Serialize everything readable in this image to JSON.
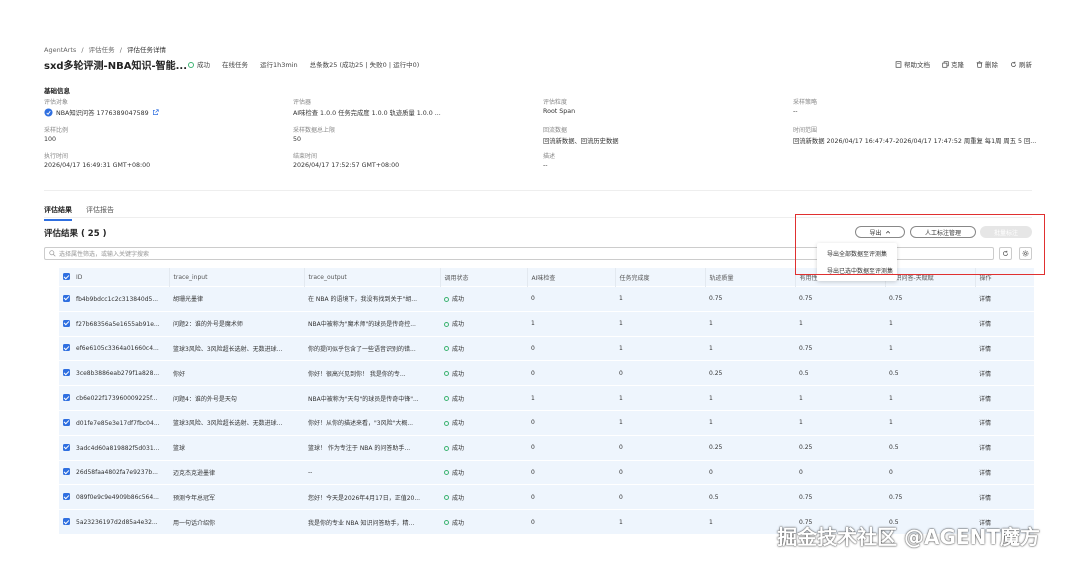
{
  "breadcrumb": [
    "AgentArts",
    "/",
    "评估任务",
    "/",
    "评估任务详情"
  ],
  "task": {
    "title": "sxd多轮评测-NBA知识-智能...",
    "status": "成功",
    "task_type": "在线任务",
    "run_time": "运行1h3min",
    "total": "总条数25 (成功25 | 失败0 | 运行中0)"
  },
  "toolbar": {
    "help": "帮助文档",
    "clone": "克隆",
    "delete": "删除",
    "refresh": "刷新"
  },
  "basic_info": {
    "section_title": "基础信息",
    "fields": [
      {
        "label": "评估对象",
        "value": "NBA知识问答  1776389047589"
      },
      {
        "label": "评估器",
        "value": "AI味检查  1.0.0  任务完成度  1.0.0  轨迹质量  1.0.0 ..."
      },
      {
        "label": "评估粒度",
        "value": "Root Span"
      },
      {
        "label": "采样策略",
        "value": "--"
      },
      {
        "label": "采样比例",
        "value": "100"
      },
      {
        "label": "采样数据总上限",
        "value": "50"
      },
      {
        "label": "回流数据",
        "value": "回流新数据、回流历史数据"
      },
      {
        "label": "时间范围",
        "value": "回流新数据 2026/04/17 16:47:47-2026/04/17 17:47:52 周重复 每1周 周五 5 回..."
      },
      {
        "label": "执行时间",
        "value": "2026/04/17 16:49:31 GMT+08:00"
      },
      {
        "label": "结束时间",
        "value": "2026/04/17 17:52:57 GMT+08:00"
      },
      {
        "label": "描述",
        "value": "--"
      }
    ]
  },
  "tabs": [
    "评估结果",
    "评估报告"
  ],
  "results": {
    "title": "评估结果 ( 25 )",
    "export_label": "导出",
    "annotate_label": "人工标注管理",
    "disabled_label": "批量标注",
    "export_menu": [
      "导出全部数据至评测集",
      "导出已选中数据至评测集"
    ],
    "search_placeholder": "选择属性筛选，或输入关键字搜索"
  },
  "table": {
    "headers": [
      "ID",
      "trace_input",
      "trace_output",
      "调用状态",
      "AI味检查",
      "任务完成度",
      "轨迹质量",
      "有用性",
      "知识问答-天赋赋",
      "操作"
    ],
    "rows": [
      [
        "fb4b9bdcc1c2c313840d5...",
        "胡珊光墨律",
        "在 NBA 的语境下，我没有找到关于\"胡...",
        "成功",
        "0",
        "1",
        "0.75",
        "0.75",
        "0.75",
        "详情"
      ],
      [
        "f27b68356a5e1655ab91e...",
        "问题2：谁的外号是魔术师",
        "NBA中被称为\"魔术师\"的球员是传奇控...",
        "成功",
        "1",
        "1",
        "1",
        "1",
        "1",
        "详情"
      ],
      [
        "ef6e6105c3364a01660c4...",
        "篮球3风险、3风险超长选射、无数进球...",
        "你的提问似乎包含了一些语音识别的错...",
        "成功",
        "0",
        "1",
        "1",
        "0.75",
        "1",
        "详情"
      ],
      [
        "3ce8b3886eab279f1a828...",
        "你好",
        "你好！很高兴见到你！ 我是你的专...",
        "成功",
        "0",
        "0",
        "0.25",
        "0.5",
        "0.5",
        "详情"
      ],
      [
        "cb6e022f173960009225f...",
        "问题4：谁的外号是天勾",
        "NBA中被称为\"天勾\"的球员是传奇中锋\"...",
        "成功",
        "1",
        "1",
        "1",
        "1",
        "1",
        "详情"
      ],
      [
        "d01fe7e85e3e17df7fbc04...",
        "篮球3风险、3风险超长选射、无数进球...",
        "你好！从你的描述来看，\"3风险\"大概...",
        "成功",
        "0",
        "1",
        "1",
        "1",
        "1",
        "详情"
      ],
      [
        "3adc4d60a819882f5d031...",
        "篮球",
        "篮球！ 作为专注于 NBA 的问答助手...",
        "成功",
        "0",
        "0",
        "0.25",
        "0.25",
        "0.5",
        "详情"
      ],
      [
        "26d58faa4802fa7e9237b...",
        "迈克杰克逊墨律",
        "--",
        "成功",
        "0",
        "0",
        "0",
        "0",
        "0",
        "详情"
      ],
      [
        "089f0e9c9e4909b86c564...",
        "预测今年总冠军",
        "您好！今天是2026年4月17日，正值20...",
        "成功",
        "0",
        "0",
        "0.5",
        "0.75",
        "0.75",
        "详情"
      ],
      [
        "5a23236197d2d85a4e32...",
        "用一句话介绍你",
        "我是你的专业 NBA 知识问答助手，精...",
        "成功",
        "0",
        "1",
        "1",
        "0.75",
        "0.5",
        "详情"
      ]
    ]
  },
  "watermark": "掘金技术社区 @AGENT魔方",
  "colors": {
    "accent": "#2f6fe0",
    "success": "#3cb371",
    "highlight": "#e03030",
    "table_bg": "#eef5fd"
  }
}
